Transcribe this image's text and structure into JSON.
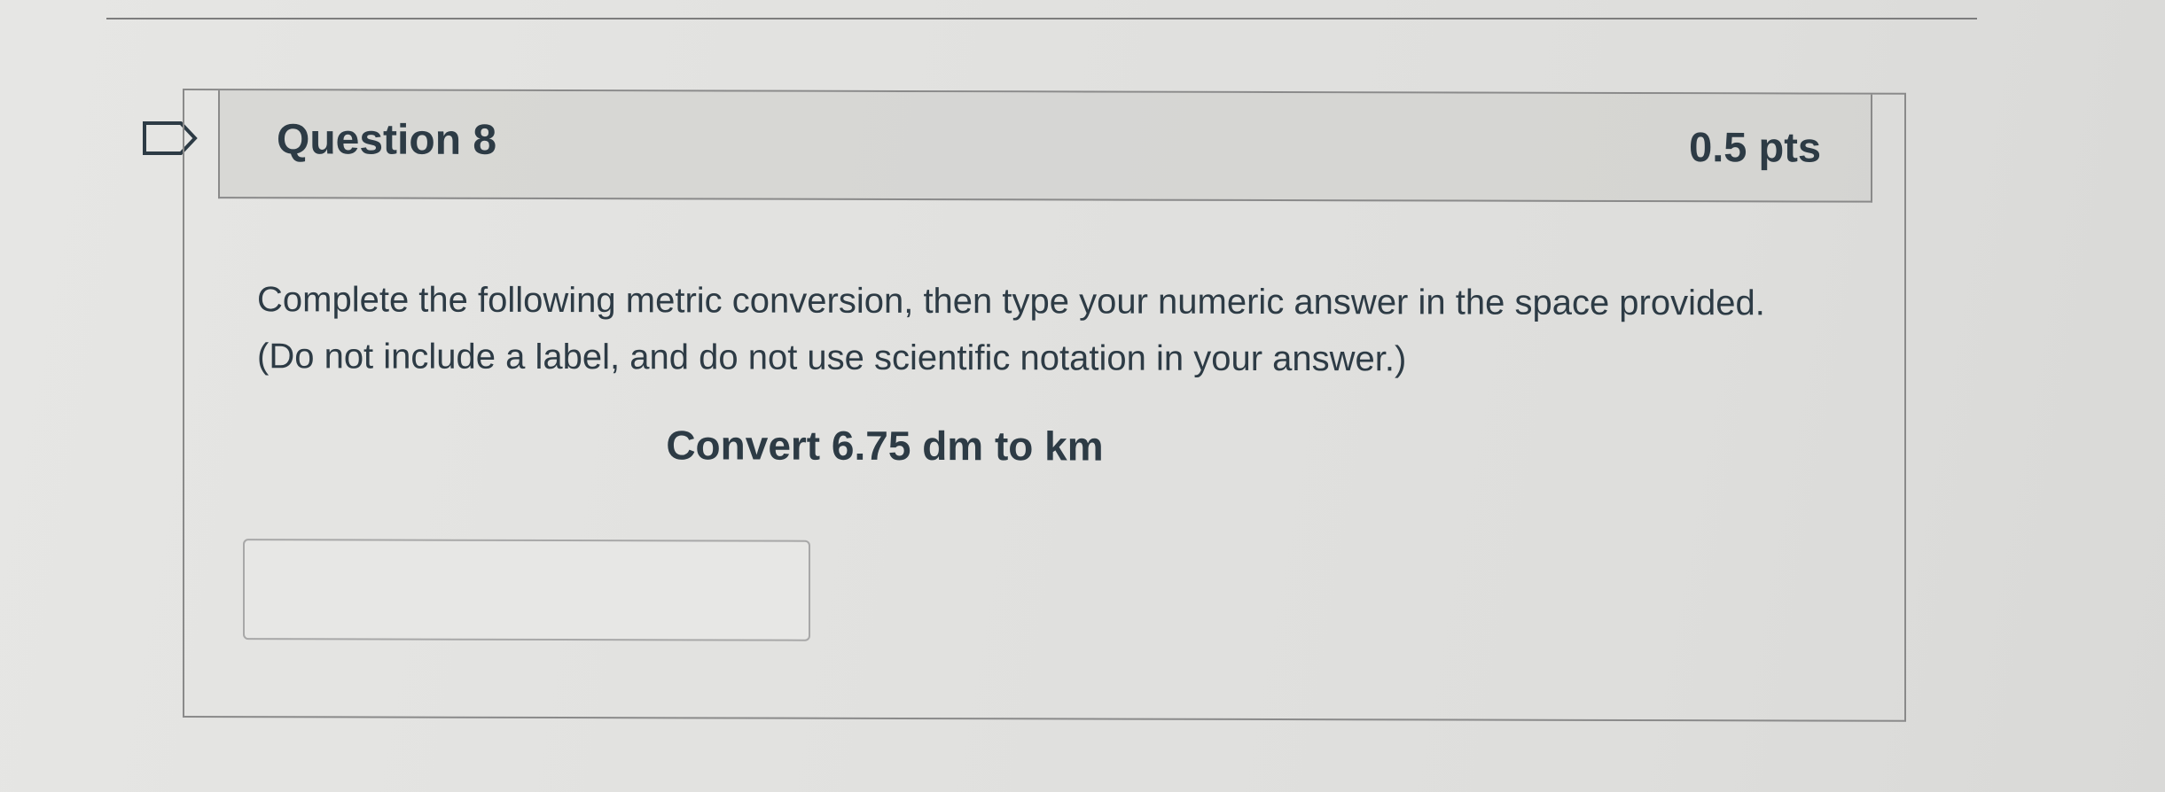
{
  "question": {
    "title": "Question 8",
    "points": "0.5 pts",
    "prompt": "Complete the following metric conversion, then type your numeric answer in the space provided. (Do not include a label, and do not use scientific notation in your answer.)",
    "instruction": "Convert 6.75 dm to km",
    "answer_value": "",
    "answer_placeholder": ""
  },
  "icons": {
    "flag": "flag-question-icon"
  },
  "colors": {
    "text": "#2d3b45",
    "border": "#8a8a8a",
    "background": "#e1e1df"
  }
}
